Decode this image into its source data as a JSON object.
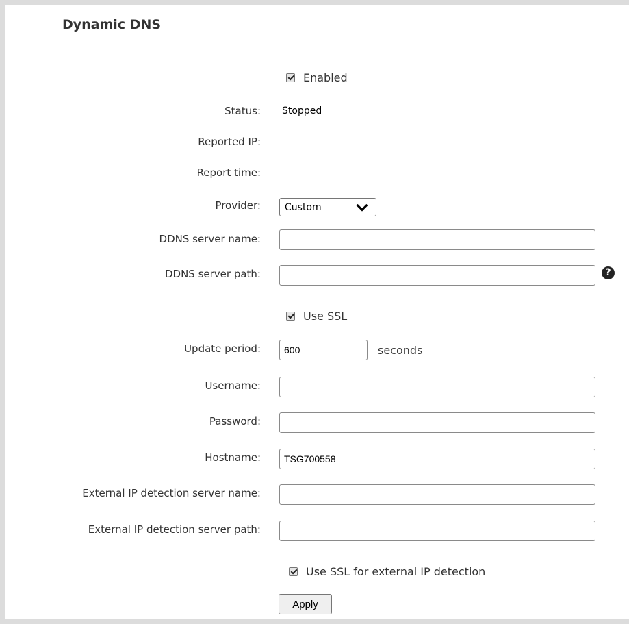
{
  "section": {
    "title": "Dynamic DNS"
  },
  "enabled": {
    "label": "Enabled",
    "checked": true
  },
  "status": {
    "label": "Status:",
    "value": "Stopped"
  },
  "reported_ip": {
    "label": "Reported IP:",
    "value": ""
  },
  "report_time": {
    "label": "Report time:",
    "value": ""
  },
  "provider": {
    "label": "Provider:",
    "selected": "Custom",
    "icon": "chevron-down-icon"
  },
  "ddns_server_name": {
    "label": "DDNS server name:",
    "value": ""
  },
  "ddns_server_path": {
    "label": "DDNS server path:",
    "value": "",
    "help_icon": "question-circle-icon",
    "help_glyph": "?"
  },
  "use_ssl": {
    "label": "Use SSL",
    "checked": true
  },
  "update_period": {
    "label": "Update period:",
    "value": "600",
    "unit": "seconds"
  },
  "username": {
    "label": "Username:",
    "value": ""
  },
  "password": {
    "label": "Password:",
    "value": ""
  },
  "hostname": {
    "label": "Hostname:",
    "value": "TSG700558"
  },
  "ext_ip_server_name": {
    "label": "External IP detection server name:",
    "value": ""
  },
  "ext_ip_server_path": {
    "label": "External IP detection server path:",
    "value": ""
  },
  "use_ssl_ext": {
    "label": "Use SSL for external IP detection",
    "checked": true
  },
  "apply": {
    "label": "Apply"
  }
}
